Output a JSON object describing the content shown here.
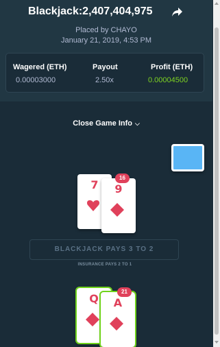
{
  "header": {
    "title": "Blackjack:2,407,404,975",
    "placed_by": "Placed by CHAYO",
    "date": "January 21, 2019, 4:53 PM"
  },
  "stats": {
    "wagered_label": "Wagered (ETH)",
    "wagered_value": "0.00003000",
    "payout_label": "Payout",
    "payout_value": "2.50x",
    "profit_label": "Profit (ETH)",
    "profit_value": "0.00004500"
  },
  "close_game_info": "Close Game Info",
  "dealer": {
    "cards": [
      {
        "rank": "7",
        "suit": "hearts"
      },
      {
        "rank": "9",
        "suit": "diamonds"
      }
    ],
    "total": "16"
  },
  "player": {
    "cards": [
      {
        "rank": "Q",
        "suit": "diamonds"
      },
      {
        "rank": "A",
        "suit": "diamonds"
      }
    ],
    "total": "21"
  },
  "table": {
    "pays_text": "BLACKJACK PAYS 3 TO 2",
    "insurance_text": "INSURANCE PAYS 2 TO 1"
  },
  "colors": {
    "background": "#1a2c38",
    "panel": "#213743",
    "red_suit": "#e0415b",
    "profit_green": "#7ed321",
    "card_back": "#59b5f5"
  }
}
